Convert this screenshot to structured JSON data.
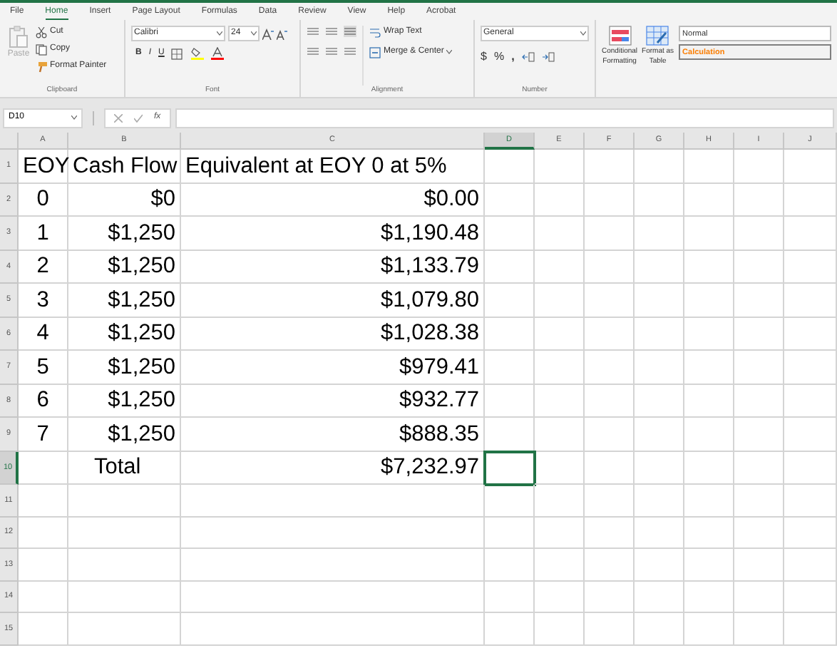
{
  "tabs": [
    {
      "label": "File",
      "selected": false
    },
    {
      "label": "Home",
      "selected": true
    },
    {
      "label": "Insert",
      "selected": false
    },
    {
      "label": "Page Layout",
      "selected": false
    },
    {
      "label": "Formulas",
      "selected": false
    },
    {
      "label": "Data",
      "selected": false
    },
    {
      "label": "Review",
      "selected": false
    },
    {
      "label": "View",
      "selected": false
    },
    {
      "label": "Help",
      "selected": false
    },
    {
      "label": "Acrobat",
      "selected": false
    }
  ],
  "clipboard": {
    "paste": "Paste",
    "paste_disabled": true,
    "cut": "Cut",
    "copy": "Copy",
    "format_painter": "Format Painter",
    "label": "Clipboard"
  },
  "font": {
    "name": "Calibri",
    "size": "24",
    "bold": "B",
    "italic": "I",
    "underline": "U",
    "label": "Font"
  },
  "alignment": {
    "wrap_text": "Wrap Text",
    "merge": "Merge & Center",
    "label": "Alignment"
  },
  "number": {
    "format": "General",
    "currency": "$",
    "percent": "%",
    "comma": ",",
    "label": "Number"
  },
  "styles": {
    "conditional": [
      "Conditional",
      "Formatting"
    ],
    "format_table": [
      "Format as",
      "Table"
    ],
    "normal": "Normal",
    "calculation": "Calculation"
  },
  "formula_bar": {
    "name_box": "D10",
    "fx": "fx"
  },
  "columns": [
    {
      "label": "A",
      "selected": false
    },
    {
      "label": "B",
      "selected": false
    },
    {
      "label": "C",
      "selected": false
    },
    {
      "label": "D",
      "selected": true
    },
    {
      "label": "E",
      "selected": false
    },
    {
      "label": "F",
      "selected": false
    },
    {
      "label": "G",
      "selected": false
    },
    {
      "label": "H",
      "selected": false
    },
    {
      "label": "I",
      "selected": false
    },
    {
      "label": "J",
      "selected": false
    }
  ],
  "rows": [
    {
      "label": "1",
      "selected": false,
      "kind": "header",
      "cells": [
        "EOY",
        "Cash Flow",
        "Equivalent at EOY 0 at 5%"
      ]
    },
    {
      "label": "2",
      "selected": false,
      "kind": "data",
      "cells": [
        "0",
        "$0",
        "$0.00"
      ]
    },
    {
      "label": "3",
      "selected": false,
      "kind": "data",
      "cells": [
        "1",
        "$1,250",
        "$1,190.48"
      ]
    },
    {
      "label": "4",
      "selected": false,
      "kind": "data",
      "cells": [
        "2",
        "$1,250",
        "$1,133.79"
      ]
    },
    {
      "label": "5",
      "selected": false,
      "kind": "data",
      "cells": [
        "3",
        "$1,250",
        "$1,079.80"
      ]
    },
    {
      "label": "6",
      "selected": false,
      "kind": "data",
      "cells": [
        "4",
        "$1,250",
        "$1,028.38"
      ]
    },
    {
      "label": "7",
      "selected": false,
      "kind": "data",
      "cells": [
        "5",
        "$1,250",
        "$979.41"
      ]
    },
    {
      "label": "8",
      "selected": false,
      "kind": "data",
      "cells": [
        "6",
        "$1,250",
        "$932.77"
      ]
    },
    {
      "label": "9",
      "selected": false,
      "kind": "data",
      "cells": [
        "7",
        "$1,250",
        "$888.35"
      ]
    },
    {
      "label": "10",
      "selected": true,
      "kind": "total",
      "cells": [
        "Total",
        "$7,232.97"
      ]
    },
    {
      "label": "11",
      "selected": false,
      "kind": "empty"
    },
    {
      "label": "12",
      "selected": false,
      "kind": "empty"
    },
    {
      "label": "13",
      "selected": false,
      "kind": "empty"
    },
    {
      "label": "14",
      "selected": false,
      "kind": "empty"
    },
    {
      "label": "15",
      "selected": false,
      "kind": "empty"
    }
  ]
}
